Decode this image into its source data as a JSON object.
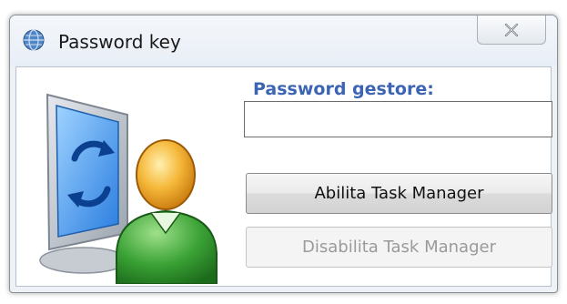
{
  "window": {
    "title": "Password key",
    "close_icon": "close-x-icon",
    "app_icon": "app-globe-icon"
  },
  "form": {
    "password_label": "Password gestore:",
    "password_value": "",
    "enable_button_label": "Abilita Task Manager",
    "disable_button_label": "Disabilita Task Manager",
    "disable_button_enabled": false
  },
  "illustration": {
    "icon": "monitor-user-refresh-icon"
  },
  "colors": {
    "label_accent": "#3c64b4",
    "monitor_blue": "#1d6fd1",
    "user_orange": "#f2a21a",
    "user_green": "#3aa235"
  }
}
